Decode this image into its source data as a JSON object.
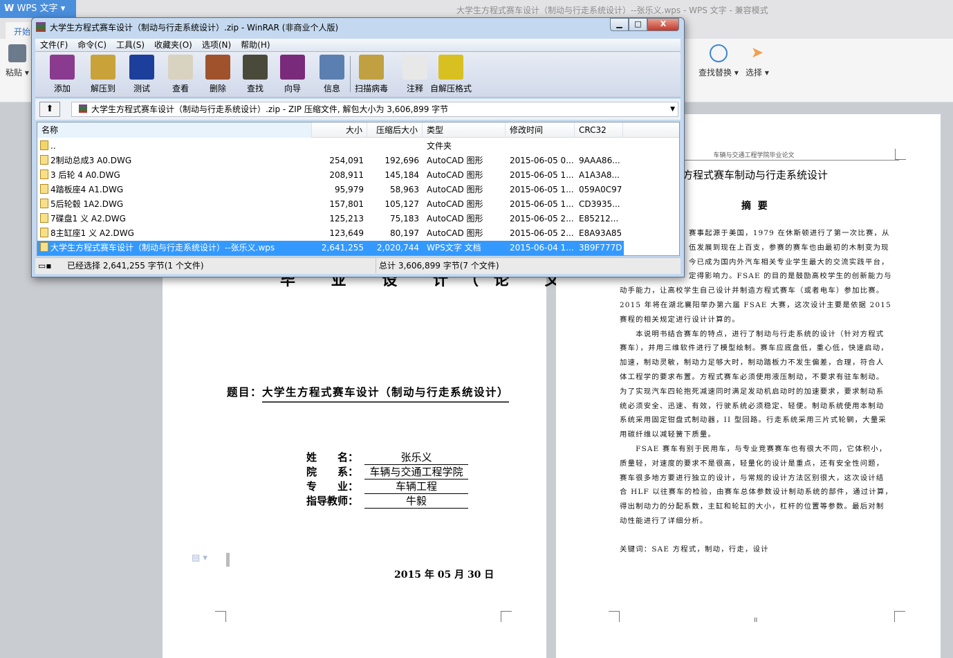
{
  "wps": {
    "app_name": "WPS 文字",
    "window_title": "大学生方程式赛车设计（制动与行走系统设计）--张乐义.wps - WPS 文字 - 兼容模式",
    "tab_start": "开始",
    "paste": "粘贴",
    "find_replace": "查找替换",
    "select": "选择"
  },
  "left_page": {
    "heading_partial": "毕 业 设 计（论 文）",
    "title_label": "题目：",
    "title": "大学生方程式赛车设计（制动与行走系统设计）",
    "fields": [
      {
        "label": "姓　　名：",
        "value": "张乐义"
      },
      {
        "label": "院　　系：",
        "value": "车辆与交通工程学院"
      },
      {
        "label": "专　　业：",
        "value": "车辆工程"
      },
      {
        "label": "指导教师：",
        "value": "牛毅"
      }
    ],
    "date": "2015 年 05 月 30 日"
  },
  "right_page": {
    "header": "车辆与交通工程学院毕业论文",
    "title_partial": "方程式赛车制动与行走系统设计",
    "abstract_heading": "摘  要",
    "lines": [
      "赛事起源于美国，1979 在休斯顿进行了第一次比赛，从",
      "伍发展到现在上百支，参赛的赛车也由最初的木制变为现",
      "今已成为国内外汽车相关专业学生最大的交流实践平台，",
      "定得影响力。FSAE 的目的是鼓励高校学生的创新能力与",
      "动手能力，让高校学生自己设计并制造方程式赛车（或者电车）参加比赛。",
      "2015 年将在湖北襄阳举办第六届 FSAE 大赛，这次设计主要是依据 2015",
      "赛程的相关规定进行设计计算的。",
      "　　本说明书结合赛车的特点，进行了制动与行走系统的设计（针对方程式",
      "赛车），并用三维软件进行了模型绘制。赛车应底盘低，重心低，快速启动，",
      "加速，制动灵敏，制动力足够大时，制动踏板力不发生偏差，合理，符合人",
      "体工程学的要求布置。方程式赛车必须使用液压制动，不要求有驻车制动。",
      "为了实现汽车四轮抱死减速同时满足发动机启动时的加速要求，要求制动系",
      "统必须安全、迅速、有效，行驶系统必须稳定、轻便。制动系统使用本制动",
      "系统采用固定钳盘式制动器，II 型回路。行走系统采用三片式轮辋，大量采",
      "用碳纤维以减轻簧下质量。",
      "　　FSAE 赛车有别于民用车，与专业竞赛赛车也有很大不同，它体积小，",
      "质量轻，对速度的要求不是很高，轻量化的设计是重点，还有安全性问题，",
      "赛车很多地方要进行独立的设计，与常规的设计方法区别很大，这次设计结",
      "合 HLF 以往赛车的检验，由赛车总体参数设计制动系统的部件，通过计算，",
      "得出制动力的分配系数，主缸和轮缸的大小，杠杆的位置等参数。最后对制",
      "动性能进行了详细分析。"
    ],
    "keywords": "关键词：SAE 方程式，制动，行走，设计",
    "page_number": "II"
  },
  "winrar": {
    "title": "大学生方程式赛车设计（制动与行走系统设计）.zip - WinRAR (非商业个人版)",
    "window_buttons": {
      "minimize": "▁",
      "maximize": "□",
      "close": "X"
    },
    "menu": [
      "文件(F)",
      "命令(C)",
      "工具(S)",
      "收藏夹(O)",
      "选项(N)",
      "帮助(H)"
    ],
    "toolbar": [
      {
        "label": "添加",
        "color": "#8a3b8f"
      },
      {
        "label": "解压到",
        "color": "#c9a23a"
      },
      {
        "label": "测试",
        "color": "#1b3f9a"
      },
      {
        "label": "查看",
        "color": "#d8d2c0"
      },
      {
        "label": "删除",
        "color": "#a0522d"
      },
      {
        "label": "查找",
        "color": "#4a4a3a"
      },
      {
        "label": "向导",
        "color": "#7a2a7a"
      },
      {
        "label": "信息",
        "color": "#5b7fb0"
      },
      {
        "label": "扫描病毒",
        "color": "#c0a040"
      },
      {
        "label": "注释",
        "color": "#e8e8e8"
      },
      {
        "label": "自解压格式",
        "color": "#d8c020"
      }
    ],
    "address": "大学生方程式赛车设计（制动与行走系统设计）.zip - ZIP 压缩文件, 解包大小为 3,606,899 字节",
    "columns": [
      "名称",
      "大小",
      "压缩后大小",
      "类型",
      "修改时间",
      "CRC32"
    ],
    "files": [
      {
        "name": "..",
        "size": "",
        "packed": "",
        "type": "文件夹",
        "modified": "",
        "crc": ""
      },
      {
        "name": "2制动总成3 A0.DWG",
        "size": "254,091",
        "packed": "192,696",
        "type": "AutoCAD 图形",
        "modified": "2015-06-05 0...",
        "crc": "9AAA86..."
      },
      {
        "name": "3 后轮 4 A0.DWG",
        "size": "208,911",
        "packed": "145,184",
        "type": "AutoCAD 图形",
        "modified": "2015-06-05 1...",
        "crc": "A1A3A8..."
      },
      {
        "name": "4踏板座4 A1.DWG",
        "size": "95,979",
        "packed": "58,963",
        "type": "AutoCAD 图形",
        "modified": "2015-06-05 1...",
        "crc": "059A0C97"
      },
      {
        "name": "5后轮毂 1A2.DWG",
        "size": "157,801",
        "packed": "105,127",
        "type": "AutoCAD 图形",
        "modified": "2015-06-05 1...",
        "crc": "CD3935..."
      },
      {
        "name": "7碟盘1 义 A2.DWG",
        "size": "125,213",
        "packed": "75,183",
        "type": "AutoCAD 图形",
        "modified": "2015-06-05 2...",
        "crc": "E85212..."
      },
      {
        "name": "8主缸座1 义 A2.DWG",
        "size": "123,649",
        "packed": "80,197",
        "type": "AutoCAD 图形",
        "modified": "2015-06-05 2...",
        "crc": "E8A93A85"
      },
      {
        "name": "大学生方程式赛车设计（制动与行走系统设计）--张乐义.wps",
        "size": "2,641,255",
        "packed": "2,020,744",
        "type": "WPS文字 文档",
        "modified": "2015-06-04 1...",
        "crc": "3B9F777D",
        "selected": true
      }
    ],
    "status_selected": "已经选择 2,641,255 字节(1 个文件)",
    "status_total": "总计 3,606,899 字节(7 个文件)"
  }
}
